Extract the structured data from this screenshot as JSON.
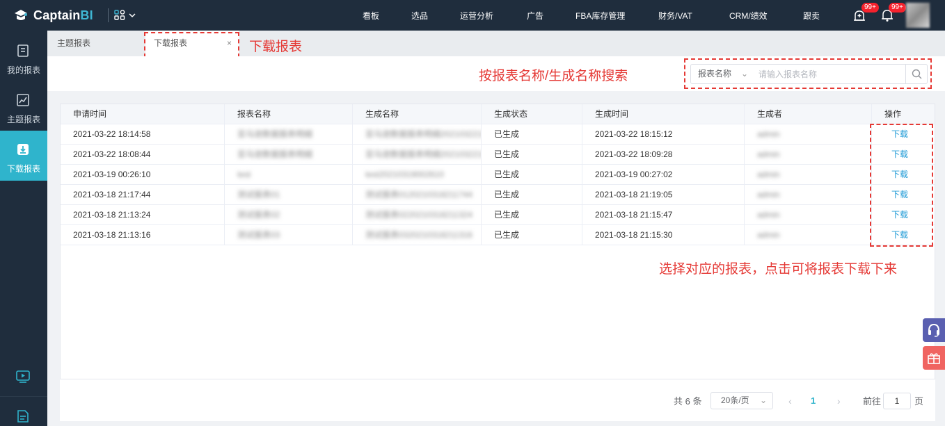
{
  "brand": {
    "name_prefix": "Captain",
    "name_suffix": "BI"
  },
  "nav": {
    "items": [
      "看板",
      "选品",
      "运营分析",
      "广告",
      "FBA库存管理",
      "财务/VAT",
      "CRM/绩效",
      "跟卖"
    ],
    "badge_a": "99+",
    "badge_b": "99+"
  },
  "sidebar": {
    "items": [
      {
        "label": "我的报表",
        "icon": "report-icon"
      },
      {
        "label": "主题报表",
        "icon": "chart-icon"
      },
      {
        "label": "下载报表",
        "icon": "download-icon",
        "active": true
      }
    ],
    "bottom_icons": [
      "video-icon",
      "document-icon"
    ]
  },
  "tabs": [
    {
      "label": "主题报表"
    },
    {
      "label": "下载报表",
      "active": true,
      "close": "×"
    }
  ],
  "annotations": {
    "tab_note": "下载报表",
    "search_note": "按报表名称/生成名称搜索",
    "action_note": "选择对应的报表，点击可将报表下载下来"
  },
  "search": {
    "field_select": "报表名称",
    "placeholder": "请输入报表名称",
    "value": ""
  },
  "table": {
    "columns": [
      "申请时间",
      "报表名称",
      "生成名称",
      "生成状态",
      "生成时间",
      "生成者",
      "操作"
    ],
    "rows": [
      {
        "apply_time": "2021-03-22 18:14:58",
        "report_name": "亚马逊数据报表明细",
        "gen_name": "亚马逊数据报表明细20210322181458",
        "status": "已生成",
        "gen_time": "2021-03-22 18:15:12",
        "creator": "admin",
        "action": "下载"
      },
      {
        "apply_time": "2021-03-22 18:08:44",
        "report_name": "亚马逊数据报表明细",
        "gen_name": "亚马逊数据报表明细20210322180844",
        "status": "已生成",
        "gen_time": "2021-03-22 18:09:28",
        "creator": "admin",
        "action": "下载"
      },
      {
        "apply_time": "2021-03-19 00:26:10",
        "report_name": "test",
        "gen_name": "test20210319002610",
        "status": "已生成",
        "gen_time": "2021-03-19 00:27:02",
        "creator": "admin",
        "action": "下载"
      },
      {
        "apply_time": "2021-03-18 21:17:44",
        "report_name": "测试报表01",
        "gen_name": "测试报表0120210318211744",
        "status": "已生成",
        "gen_time": "2021-03-18 21:19:05",
        "creator": "admin",
        "action": "下载"
      },
      {
        "apply_time": "2021-03-18 21:13:24",
        "report_name": "测试报表02",
        "gen_name": "测试报表0220210318211324",
        "status": "已生成",
        "gen_time": "2021-03-18 21:15:47",
        "creator": "admin",
        "action": "下载"
      },
      {
        "apply_time": "2021-03-18 21:13:16",
        "report_name": "测试报表03",
        "gen_name": "测试报表0320210318211316",
        "status": "已生成",
        "gen_time": "2021-03-18 21:15:30",
        "creator": "admin",
        "action": "下载"
      }
    ]
  },
  "pager": {
    "total": "共 6 条",
    "page_size": "20条/页",
    "prev": "‹",
    "next": "›",
    "current": "1",
    "goto_label": "前往",
    "goto_value": "1",
    "page_unit": "页"
  },
  "colors": {
    "accent": "#2fb4cc",
    "nav_bg": "#1f2d3d",
    "annotation": "#e53935",
    "link": "#1e9ad6"
  }
}
